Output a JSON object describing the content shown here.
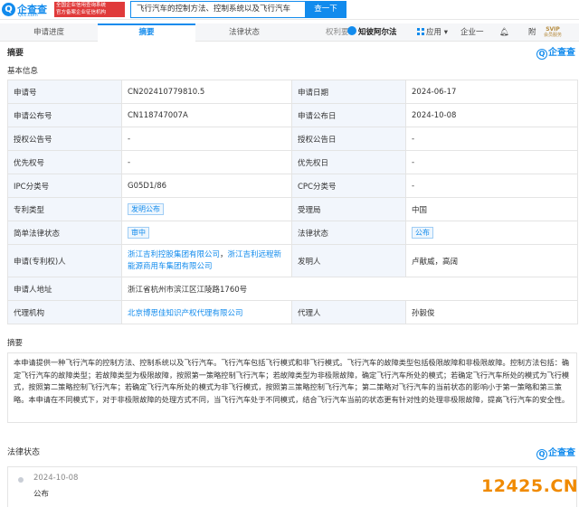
{
  "header": {
    "logo_text": "企查查",
    "logo_sub": "Qcc.com",
    "badge_line1": "全国企业信用查询系统",
    "badge_line2": "官方备案企业征信机构",
    "search_value": "飞行汽车的控制方法、控制系统以及飞行汽车",
    "search_button": "查一下"
  },
  "tabs": [
    {
      "label": "申请进度"
    },
    {
      "label": "摘要"
    },
    {
      "label": "法律状态"
    }
  ],
  "toolbar": {
    "rights": "权利要",
    "zhibi": "知彼阿尔法",
    "apps": "应用",
    "enterprise": "企业一",
    "fu": "附",
    "svip": "SVIP",
    "svip_sub": "会员服务"
  },
  "summary_title": "摘要",
  "basic_info_title": "基本信息",
  "qcc_mark": "企查查",
  "info": {
    "app_no_label": "申请号",
    "app_no": "CN202410779810.5",
    "app_date_label": "申请日期",
    "app_date": "2024-06-17",
    "pub_no_label": "申请公布号",
    "pub_no": "CN118747007A",
    "pub_date_label": "申请公布日",
    "pub_date": "2024-10-08",
    "grant_no_label": "授权公告号",
    "grant_no": "-",
    "grant_date_label": "授权公告日",
    "grant_date": "-",
    "priority_no_label": "优先权号",
    "priority_no": "-",
    "priority_date_label": "优先权日",
    "priority_date": "-",
    "ipc_label": "IPC分类号",
    "ipc": "G05D1/86",
    "cpc_label": "CPC分类号",
    "cpc": "-",
    "type_label": "专利类型",
    "type": "发明公布",
    "office_label": "受理局",
    "office": "中国",
    "simple_status_label": "简单法律状态",
    "simple_status": "审中",
    "legal_status_label": "法律状态",
    "legal_status": "公布",
    "applicant_label": "申请(专利权)人",
    "applicant_1": "浙江吉利控股集团有限公司",
    "applicant_sep": "，",
    "applicant_2": "浙江吉利远程新能源商用车集团有限公司",
    "inventor_label": "发明人",
    "inventor": "卢献威，高阔",
    "address_label": "申请人地址",
    "address": "浙江省杭州市滨江区江陵路1760号",
    "agency_label": "代理机构",
    "agency": "北京博思佳知识产权代理有限公司",
    "agent_label": "代理人",
    "agent": "孙毅俊"
  },
  "abstract_title": "摘要",
  "abstract_text": "本申请提供一种飞行汽车的控制方法、控制系统以及飞行汽车。飞行汽车包括飞行模式和非飞行模式。飞行汽车的故障类型包括极限故障和非极限故障。控制方法包括：确定飞行汽车的故障类型；若故障类型为极限故障，按照第一策略控制飞行汽车；若故障类型为非极限故障，确定飞行汽车所处的模式；若确定飞行汽车所处的模式为飞行模式，按照第二策略控制飞行汽车；若确定飞行汽车所处的模式为非飞行模式，按照第三策略控制飞行汽车；第二策略对飞行汽车的当前状态的影响小于第一策略和第三策略。本申请在不同模式下，对于非极限故障的处理方式不同，当飞行汽车处于不同模式，结合飞行汽车当前的状态更有针对性的处理非极限故障，提高飞行汽车的安全性。",
  "legal_title": "法律状态",
  "timeline": [
    {
      "date": "2024-10-08",
      "status": "公布"
    }
  ],
  "watermark": "12425.CN",
  "colors": {
    "accent": "#128bed",
    "label_bg": "#f2f6fc",
    "watermark": "#f08a00"
  }
}
